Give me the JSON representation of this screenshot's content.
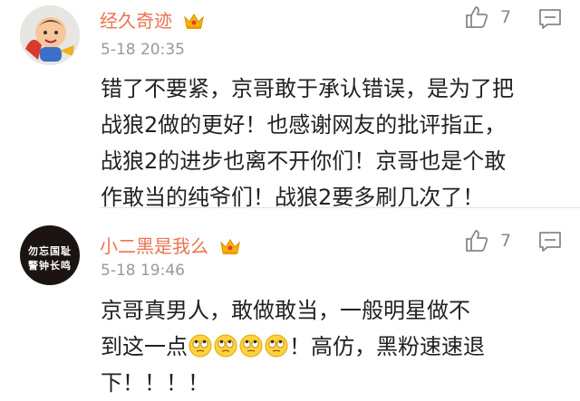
{
  "comments": [
    {
      "username": "经久奇迹",
      "time": "5-18 20:35",
      "likes": "7",
      "lines": [
        "错了不要紧，京哥敢于承认错误，是为了把",
        "战狼2做的更好！也感谢网友的批评指正，",
        "战狼2的进步也离不开你们！京哥也是个敢",
        "作敢当的纯爷们！战狼2要多刷几次了！"
      ]
    },
    {
      "username": "小二黑是我么",
      "time": "5-18 19:46",
      "likes": "7",
      "avatar_lines": [
        "勿忘国耻",
        "警钟长鸣"
      ],
      "lines": [
        "京哥真男人，敢做敢当，一般明星做不",
        "到这一点",
        "！高仿，黑粉速速退",
        "下！！！！"
      ],
      "emoji_count": 4
    }
  ],
  "colors": {
    "username": "#eb7350",
    "time": "#999999",
    "text": "#222222",
    "icon": "#888888"
  },
  "icons": {
    "badge": "crown-icon",
    "like": "thumbs-up-icon",
    "reply": "comment-icon",
    "emoji": "rolling-eyes-emoji-icon"
  }
}
